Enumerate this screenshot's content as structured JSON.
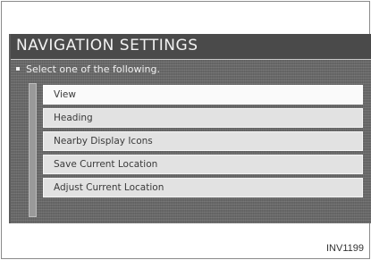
{
  "title": "NAVIGATION SETTINGS",
  "prompt": "Select one of the following.",
  "menu": {
    "items": [
      {
        "label": "View",
        "selected": true
      },
      {
        "label": "Heading",
        "selected": false
      },
      {
        "label": "Nearby Display Icons",
        "selected": false
      },
      {
        "label": "Save Current Location",
        "selected": false
      },
      {
        "label": "Adjust Current Location",
        "selected": false
      }
    ]
  },
  "caption": "INV1199",
  "colors": {
    "screen_background": "#6a6a6a",
    "title_bar": "#4a4a4a",
    "menu_item": "#e2e2e2",
    "menu_item_selected": "#fafafa"
  }
}
